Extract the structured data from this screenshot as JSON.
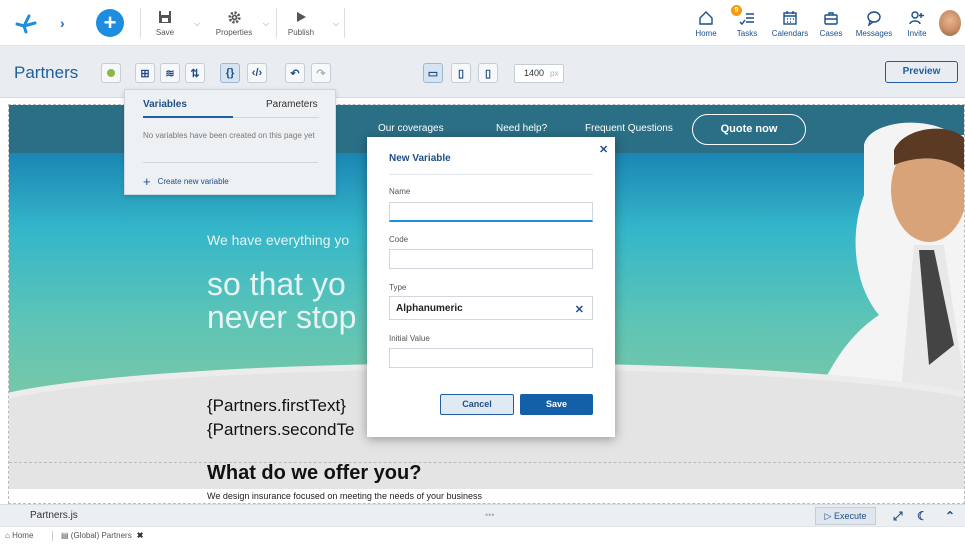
{
  "toolbar": {
    "save_label": "Save",
    "properties_label": "Properties",
    "publish_label": "Publish"
  },
  "nav": {
    "home": "Home",
    "tasks": "Tasks",
    "tasks_badge": "9",
    "calendars": "Calendars",
    "cases": "Cases",
    "messages": "Messages",
    "invite": "Invite"
  },
  "page": {
    "title": "Partners",
    "width_value": "1400",
    "width_unit": "px",
    "preview_label": "Preview"
  },
  "canvas": {
    "nav_links": [
      "Our coverages",
      "Need help?",
      "Frequent Questions"
    ],
    "quote_button": "Quote now",
    "hero_small": "We have everything yo",
    "hero_big_1": "so that yo",
    "hero_big_2": "never stop",
    "bind_1": "{Partners.firstText}",
    "bind_2": "{Partners.secondTe",
    "offer_title": "What do we offer you?",
    "offer_subtitle": "We design insurance focused on meeting the needs of your business"
  },
  "variables_panel": {
    "tab_variables": "Variables",
    "tab_parameters": "Parameters",
    "empty_message": "No variables have been created on this page yet",
    "create_label": "Create new variable"
  },
  "modal": {
    "title": "New Variable",
    "name_label": "Name",
    "name_value": "",
    "code_label": "Code",
    "code_value": "",
    "type_label": "Type",
    "type_value": "Alphanumeric",
    "initial_value_label": "Initial Value",
    "initial_value": "",
    "cancel_label": "Cancel",
    "save_label": "Save"
  },
  "console": {
    "file": "Partners.js",
    "grip": "•••",
    "execute_label": "Execute"
  },
  "footer": {
    "home": "Home",
    "tab": "(Global) Partners"
  },
  "colors": {
    "primary": "#1f5f9e",
    "accent": "#1e8de0",
    "hero_teal": "#2a6f86"
  }
}
